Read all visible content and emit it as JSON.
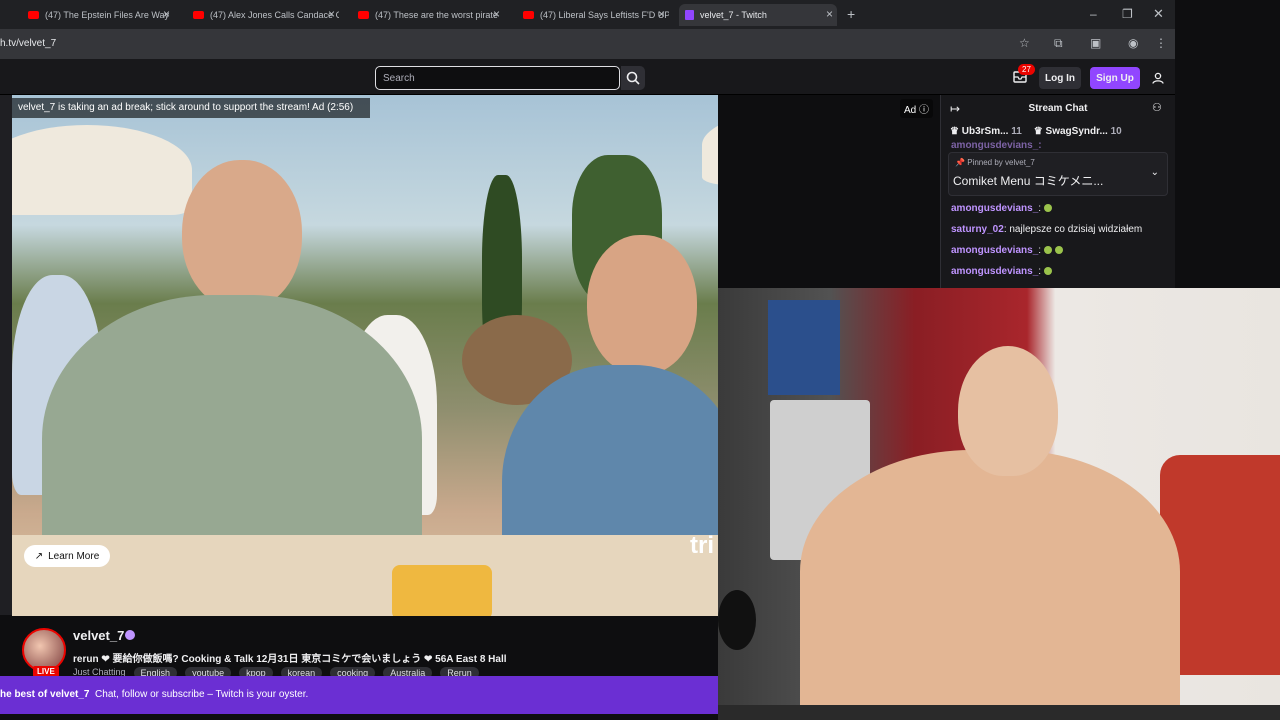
{
  "browser": {
    "tabs": [
      {
        "label": "(47) The Epstein Files Are Way",
        "kind": "youtube"
      },
      {
        "label": "(47) Alex Jones Calls Candace C",
        "kind": "youtube"
      },
      {
        "label": "(47) These are the worst pirate",
        "kind": "youtube"
      },
      {
        "label": "(47) Liberal Says Leftists F'D UP",
        "kind": "youtube"
      },
      {
        "label": "velvet_7 - Twitch",
        "kind": "twitch"
      }
    ],
    "url": "h.tv/velvet_7"
  },
  "twitch_nav": {
    "search_placeholder": "Search",
    "inbox_count": "27",
    "login_label": "Log In",
    "signup_label": "Sign Up"
  },
  "player": {
    "ad_banner": "velvet_7 is taking an ad break; stick around to support the stream! Ad (2:56)",
    "ad_label": "Ad",
    "learn_more_label": "Learn More",
    "overlay_text": "tri"
  },
  "stream_info": {
    "channel_name": "velvet_7",
    "live_label": "LIVE",
    "title": "rerun ❤ 要給你做飯嗎? Cooking & Talk 12月31日 東京コミケで会いましょう ❤ 56A East 8 Hall",
    "category": "Just Chatting",
    "tags": [
      "English",
      "youtube",
      "kpop",
      "korean",
      "cooking",
      "Australia",
      "Rerun"
    ]
  },
  "promo_bar": {
    "bold_text": "he best of velvet_7",
    "text": "Chat, follow or subscribe – Twitch is your oyster."
  },
  "chat": {
    "header": "Stream Chat",
    "gifters": [
      {
        "name": "Ub3rSm...",
        "count": "11"
      },
      {
        "name": "SwagSyndr...",
        "count": "10"
      }
    ],
    "truncated_top_line": "amongusdevians_:",
    "pinned": {
      "pinned_by": "Pinned by",
      "pinned_by_user": "velvet_7",
      "message": "Comiket Menu コミケメニ..."
    },
    "messages": [
      {
        "user": "amongusdevians_",
        "text": "",
        "dots": 1,
        "color": "#bf94ff"
      },
      {
        "user": "saturny_02",
        "text": "najlepsze co dzisiaj widziałem",
        "dots": 0,
        "color": "#bf94ff"
      },
      {
        "user": "amongusdevians_",
        "text": "",
        "dots": 2,
        "color": "#bf94ff"
      },
      {
        "user": "amongusdevians_",
        "text": "",
        "dots": 1,
        "color": "#bf94ff"
      }
    ]
  },
  "colors": {
    "twitch_purple": "#9146ff",
    "promo_purple": "#6b2fd3",
    "live_red": "#eb0400"
  }
}
